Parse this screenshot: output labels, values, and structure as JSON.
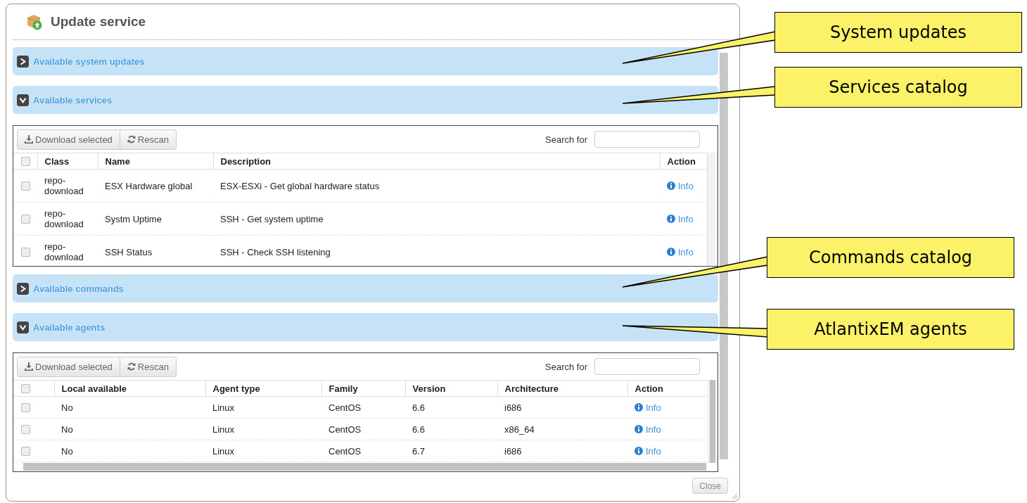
{
  "window": {
    "title": "Update service"
  },
  "sections": [
    {
      "title": "Available system updates",
      "expanded": false
    },
    {
      "title": "Available services",
      "expanded": true,
      "toolbar": {
        "buttons": [
          {
            "label": "Download selected",
            "kind": "download"
          },
          {
            "label": "Rescan",
            "kind": "rescan"
          }
        ],
        "search_label": "Search for"
      },
      "select_all_checked": false,
      "columns": [
        "Class",
        "Name",
        "Description",
        "Action"
      ],
      "rows": [
        {
          "checked": false,
          "cells": [
            "repo-download",
            "ESX Hardware global",
            "ESX-ESXi - Get global hardware status"
          ],
          "action": "Info"
        },
        {
          "checked": false,
          "cells": [
            "repo-download",
            "Systm Uptime",
            "SSH - Get system uptime"
          ],
          "action": "Info"
        },
        {
          "checked": false,
          "cells": [
            "repo-download",
            "SSH Status",
            "SSH - Check SSH listening"
          ],
          "action": "Info"
        }
      ]
    },
    {
      "title": "Available commands",
      "expanded": false
    },
    {
      "title": "Available agents",
      "expanded": true,
      "toolbar": {
        "buttons": [
          {
            "label": "Download selected",
            "kind": "download"
          },
          {
            "label": "Rescan",
            "kind": "rescan"
          }
        ],
        "search_label": "Search for"
      },
      "select_all_checked": false,
      "columns": [
        "Local available",
        "Agent type",
        "Family",
        "Version",
        "Architecture",
        "Action"
      ],
      "rows": [
        {
          "checked": false,
          "cells": [
            "No",
            "Linux",
            "CentOS",
            "6.6",
            "i686"
          ],
          "action": "Info"
        },
        {
          "checked": false,
          "cells": [
            "No",
            "Linux",
            "CentOS",
            "6.6",
            "x86_64"
          ],
          "action": "Info"
        },
        {
          "checked": false,
          "cells": [
            "No",
            "Linux",
            "CentOS",
            "6.7",
            "i686"
          ],
          "action": "Info"
        }
      ]
    }
  ],
  "close_button": "Close",
  "callouts": [
    {
      "text": "System updates"
    },
    {
      "text": "Services catalog"
    },
    {
      "text": "Commands catalog"
    },
    {
      "text": "AtlantixEM agents"
    }
  ]
}
